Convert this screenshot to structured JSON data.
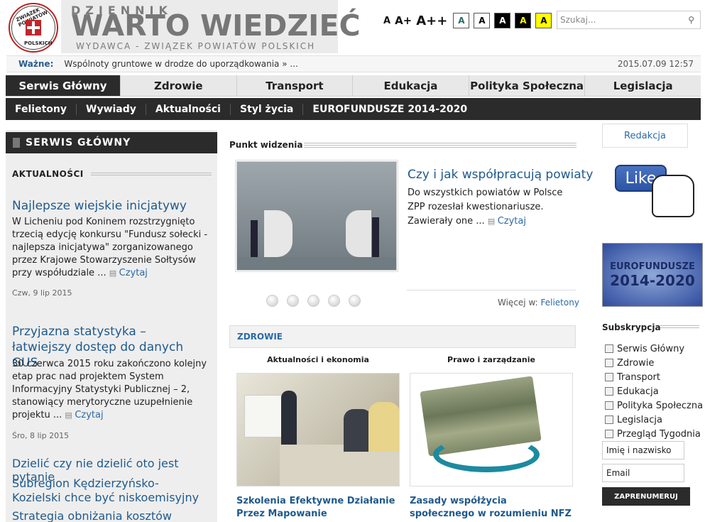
{
  "header": {
    "logo_text_top": "ZWIĄZEK POWIATÓW",
    "logo_text_bottom": "POLSKICH",
    "masthead_small": "DZIENNIK",
    "masthead_big": "WARTO WIEDZIEĆ",
    "masthead_sub": "WYDAWCA - ZWIĄZEK POWIATÓW POLSKICH",
    "font_sizes": [
      "A",
      "A+",
      "A++"
    ],
    "contrast_options": [
      {
        "label": "A",
        "bg": "#ffffff",
        "fg": "#2a6a6a"
      },
      {
        "label": "A",
        "bg": "#ffffff",
        "fg": "#000000"
      },
      {
        "label": "A",
        "bg": "#000000",
        "fg": "#ffffff"
      },
      {
        "label": "A",
        "bg": "#000000",
        "fg": "#ffff00"
      },
      {
        "label": "A",
        "bg": "#ffff00",
        "fg": "#000000"
      }
    ],
    "search_placeholder": "Szukaj...",
    "search_icon": "magnifier-icon"
  },
  "ticker": {
    "label": "Ważne:",
    "message": "Wspólnoty gruntowe w drodze do uporządkowania  »  ...",
    "datetime": "2015.07.09 12:57"
  },
  "main_nav": [
    "Serwis Główny",
    "Zdrowie",
    "Transport",
    "Edukacja",
    "Polityka Społeczna",
    "Legislacja"
  ],
  "sub_nav": [
    "Felietony",
    "Wywiady",
    "Aktualności",
    "Styl życia",
    "EUROFUNDUSZE 2014-2020"
  ],
  "left": {
    "header": "SERWIS GŁÓWNY",
    "section": "AKTUALNOŚCI",
    "articles": [
      {
        "title": "Najlepsze wiejskie inicjatywy",
        "body": "W Licheniu pod Koninem rozstrzygnięto trzecią edycję konkursu \"Fundusz sołecki - najlepsza inicjatywa\" zorganizowanego przez Krajowe Stowarzyszenie Sołtysów przy współudziale ...",
        "read": "Czytaj",
        "date": "Czw, 9 lip 2015"
      },
      {
        "title": "Przyjazna statystyka – łatwiejszy dostęp do danych GUS",
        "body": "30 czerwca 2015 roku zakończono kolejny etap prac nad projektem System Informacyjny Statystyki Publicznej – 2, stanowiący merytoryczne uzupełnienie projektu ...",
        "read": "Czytaj",
        "date": "Śro, 8 lip 2015"
      }
    ],
    "links": [
      "Dzielić czy nie dzielić oto jest pytanie",
      "Subregion Kędzierzyńsko-Kozielski chce być niskoemisyjny",
      "Strategia obniżania kosztów"
    ]
  },
  "center": {
    "section": "Punkt widzenia",
    "slide_title": "Czy i jak współpracują powiaty",
    "slide_body": "Do wszystkich powiatów w Polsce ZPP rozesłał kwestionariusze. Zawierały one ...",
    "slide_read": "Czytaj",
    "more_label": "Więcej w:",
    "more_link": "Felietony",
    "zdrowie_header": "ZDROWIE",
    "col1_title": "Aktualności i ekonomia",
    "col2_title": "Prawo i zarządzanie",
    "col1_caption": "Szkolenia Efektywne Działanie Przez Mapowanie",
    "col2_caption": "Zasady współżycia społecznego w rozumieniu NFZ"
  },
  "right": {
    "redakcja": "Redakcja",
    "like": "Like",
    "eurofundusze_a": "EUROFUNDUSZE",
    "eurofundusze_b": "2014-2020",
    "subs_title": "Subskrypcja",
    "subs_options": [
      "Serwis Główny",
      "Zdrowie",
      "Transport",
      "Edukacja",
      "Polityka Społeczna",
      "Legislacja",
      "Przegląd Tygodnia"
    ],
    "name_placeholder": "Imię i nazwisko",
    "email_placeholder": "Email",
    "submit": "ZAPRENUMERUJ"
  }
}
